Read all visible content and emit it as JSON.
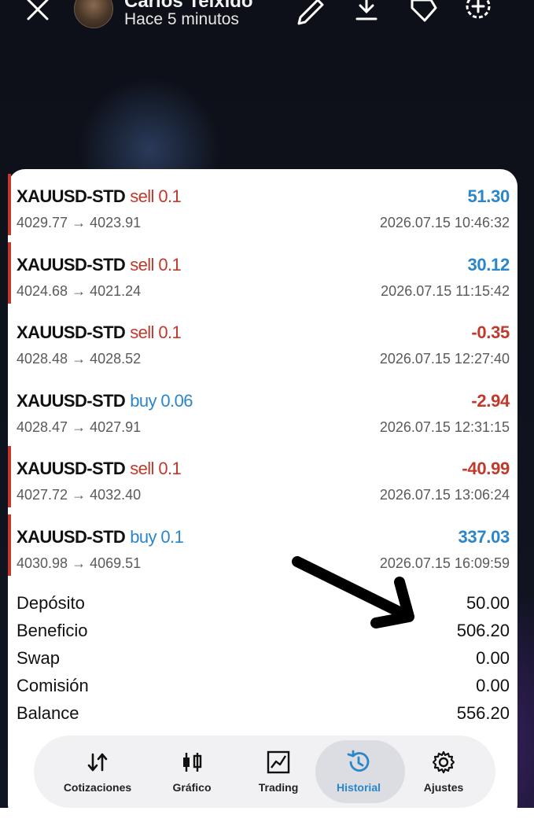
{
  "story": {
    "author": "Carlos Teixido",
    "time": "Hace 5 minutos"
  },
  "trades": [
    {
      "symbol": "XAUUSD-STD",
      "side": "sell",
      "volume": "0.1",
      "profit": "51.30",
      "prices": "4029.77 → 4023.91",
      "datetime": "2026.07.15 10:46:32",
      "marked": true
    },
    {
      "symbol": "XAUUSD-STD",
      "side": "sell",
      "volume": "0.1",
      "profit": "30.12",
      "prices": "4024.68 → 4021.24",
      "datetime": "2026.07.15 11:15:42",
      "marked": true
    },
    {
      "symbol": "XAUUSD-STD",
      "side": "sell",
      "volume": "0.1",
      "profit": "-0.35",
      "prices": "4028.48 → 4028.52",
      "datetime": "2026.07.15 12:27:40",
      "marked": false
    },
    {
      "symbol": "XAUUSD-STD",
      "side": "buy",
      "volume": "0.06",
      "profit": "-2.94",
      "prices": "4028.47 → 4027.91",
      "datetime": "2026.07.15 12:31:15",
      "marked": false
    },
    {
      "symbol": "XAUUSD-STD",
      "side": "sell",
      "volume": "0.1",
      "profit": "-40.99",
      "prices": "4027.72 → 4032.40",
      "datetime": "2026.07.15 13:06:24",
      "marked": true
    },
    {
      "symbol": "XAUUSD-STD",
      "side": "buy",
      "volume": "0.1",
      "profit": "337.03",
      "prices": "4030.98 → 4069.51",
      "datetime": "2026.07.15 16:09:59",
      "marked": true
    }
  ],
  "summary": [
    {
      "label": "Depósito",
      "value": "50.00"
    },
    {
      "label": "Beneficio",
      "value": "506.20"
    },
    {
      "label": "Swap",
      "value": "0.00"
    },
    {
      "label": "Comisión",
      "value": "0.00"
    },
    {
      "label": "Balance",
      "value": "556.20"
    }
  ],
  "tabs": [
    {
      "label": "Cotizaciones",
      "icon": "sort-arrows-icon",
      "active": false
    },
    {
      "label": "Gráfico",
      "icon": "candlestick-icon",
      "active": false
    },
    {
      "label": "Trading",
      "icon": "line-chart-icon",
      "active": false
    },
    {
      "label": "Historial",
      "icon": "history-clock-icon",
      "active": true
    },
    {
      "label": "Ajustes",
      "icon": "gear-icon",
      "active": false
    }
  ],
  "colors": {
    "sell": "#c0392b",
    "buy": "#2a86c9",
    "profit_positive": "#2a86c9",
    "profit_negative": "#c0392b",
    "active_tab": "#2a86c9"
  }
}
